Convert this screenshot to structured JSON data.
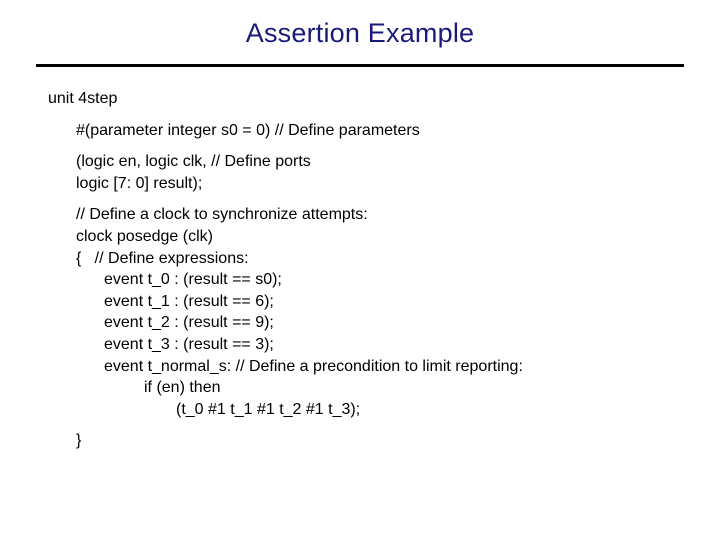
{
  "title": "Assertion Example",
  "lines": {
    "unit": "unit 4step",
    "param": "#(parameter integer s0 = 0) // Define parameters",
    "ports1": "(logic en, logic clk, // Define ports",
    "ports2": "logic [7: 0] result);",
    "clkcomment": "// Define a clock to synchronize attempts:",
    "clkdecl": "clock posedge (clk)",
    "openexpr": "{   // Define expressions:",
    "ev0": "event t_0 : (result == s0);",
    "ev1": "event t_1 : (result == 6);",
    "ev2": "event t_2 : (result == 9);",
    "ev3": "event t_3 : (result == 3);",
    "evn": "event t_normal_s: // Define a precondition to limit reporting:",
    "ifthen": "if (en) then",
    "seq": "(t_0 #1 t_1 #1 t_2 #1 t_3);",
    "close": "}"
  }
}
